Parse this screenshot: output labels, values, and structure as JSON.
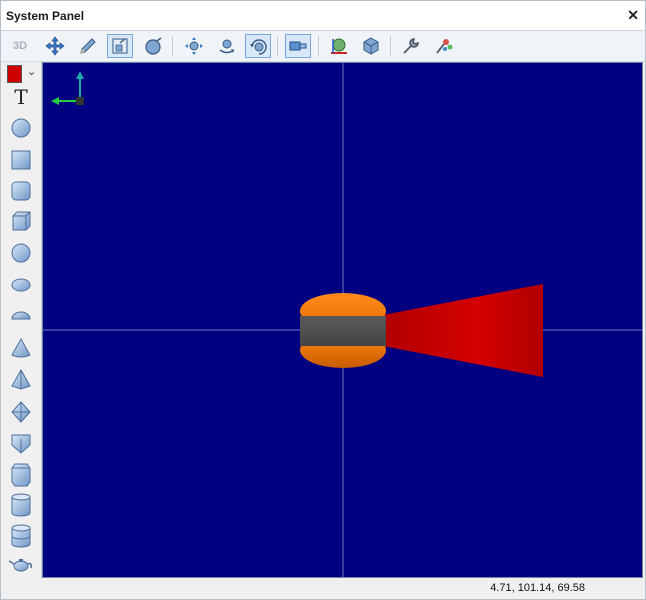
{
  "window": {
    "title": "System Panel",
    "close_glyph": "✕"
  },
  "toolbar": {
    "label_3d": "3D",
    "buttons": [
      {
        "icon": "move-icon",
        "active": false
      },
      {
        "icon": "pencil-icon",
        "active": false
      },
      {
        "icon": "zoom-box-icon",
        "active": true
      },
      {
        "icon": "zoom-icon",
        "active": false
      },
      {
        "icon": "pan-icon",
        "active": false
      },
      {
        "icon": "rotate-icon",
        "active": false
      },
      {
        "icon": "orbit-icon",
        "active": true
      },
      {
        "icon": "view-box-icon",
        "active": true
      },
      {
        "icon": "axis-icon",
        "active": false
      },
      {
        "icon": "cube-view-icon",
        "active": false
      },
      {
        "icon": "wrench-icon",
        "active": false
      },
      {
        "icon": "settings-tools-icon",
        "active": false
      }
    ]
  },
  "sidebar": {
    "color": "#cc0000",
    "text_tool": "T",
    "tools": [
      "circle-icon",
      "square-icon",
      "rounded-square-icon",
      "cube-icon",
      "sphere-icon",
      "ellipsoid-icon",
      "half-ellipsoid-icon",
      "cone-icon",
      "pyramid-icon",
      "octahedron-icon",
      "prism-icon",
      "hex-prism-icon",
      "cylinder-icon",
      "drum-icon",
      "teapot-icon"
    ]
  },
  "viewport": {
    "background": "#000080"
  },
  "status": {
    "coordinates": "4.71, 101.14, 69.58"
  }
}
